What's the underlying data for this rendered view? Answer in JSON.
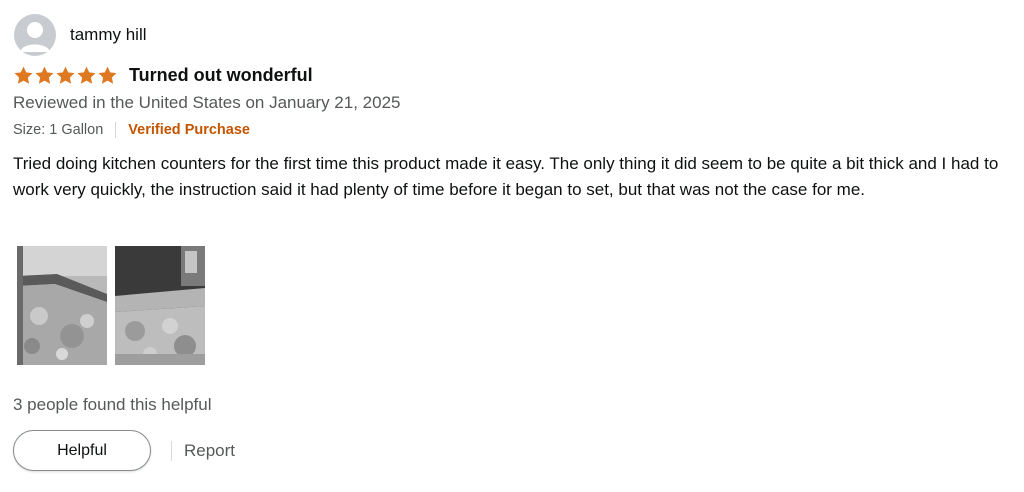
{
  "reviewer": {
    "name": "tammy hill",
    "avatar_icon": "user-avatar-icon"
  },
  "rating": {
    "stars": 5,
    "out_of": 5,
    "star_color": "#de7921"
  },
  "review": {
    "title": "Turned out wonderful",
    "date_line": "Reviewed in the United States on January 21, 2025",
    "variant": "Size: 1 Gallon",
    "verified_label": "Verified Purchase",
    "body": "Tried doing kitchen counters for the first time this product made it easy. The only thing it did seem to be quite a bit thick and I had to work very quickly, the instruction said it had plenty of time before it began to set, but that was not the case for me.",
    "image_count": 2
  },
  "footer": {
    "helpful_count_text": "3 people found this helpful",
    "helpful_button": "Helpful",
    "report_link": "Report"
  },
  "colors": {
    "text": "#0f1111",
    "secondary_text": "#565959",
    "verified": "#c45500",
    "star": "#de7921"
  }
}
